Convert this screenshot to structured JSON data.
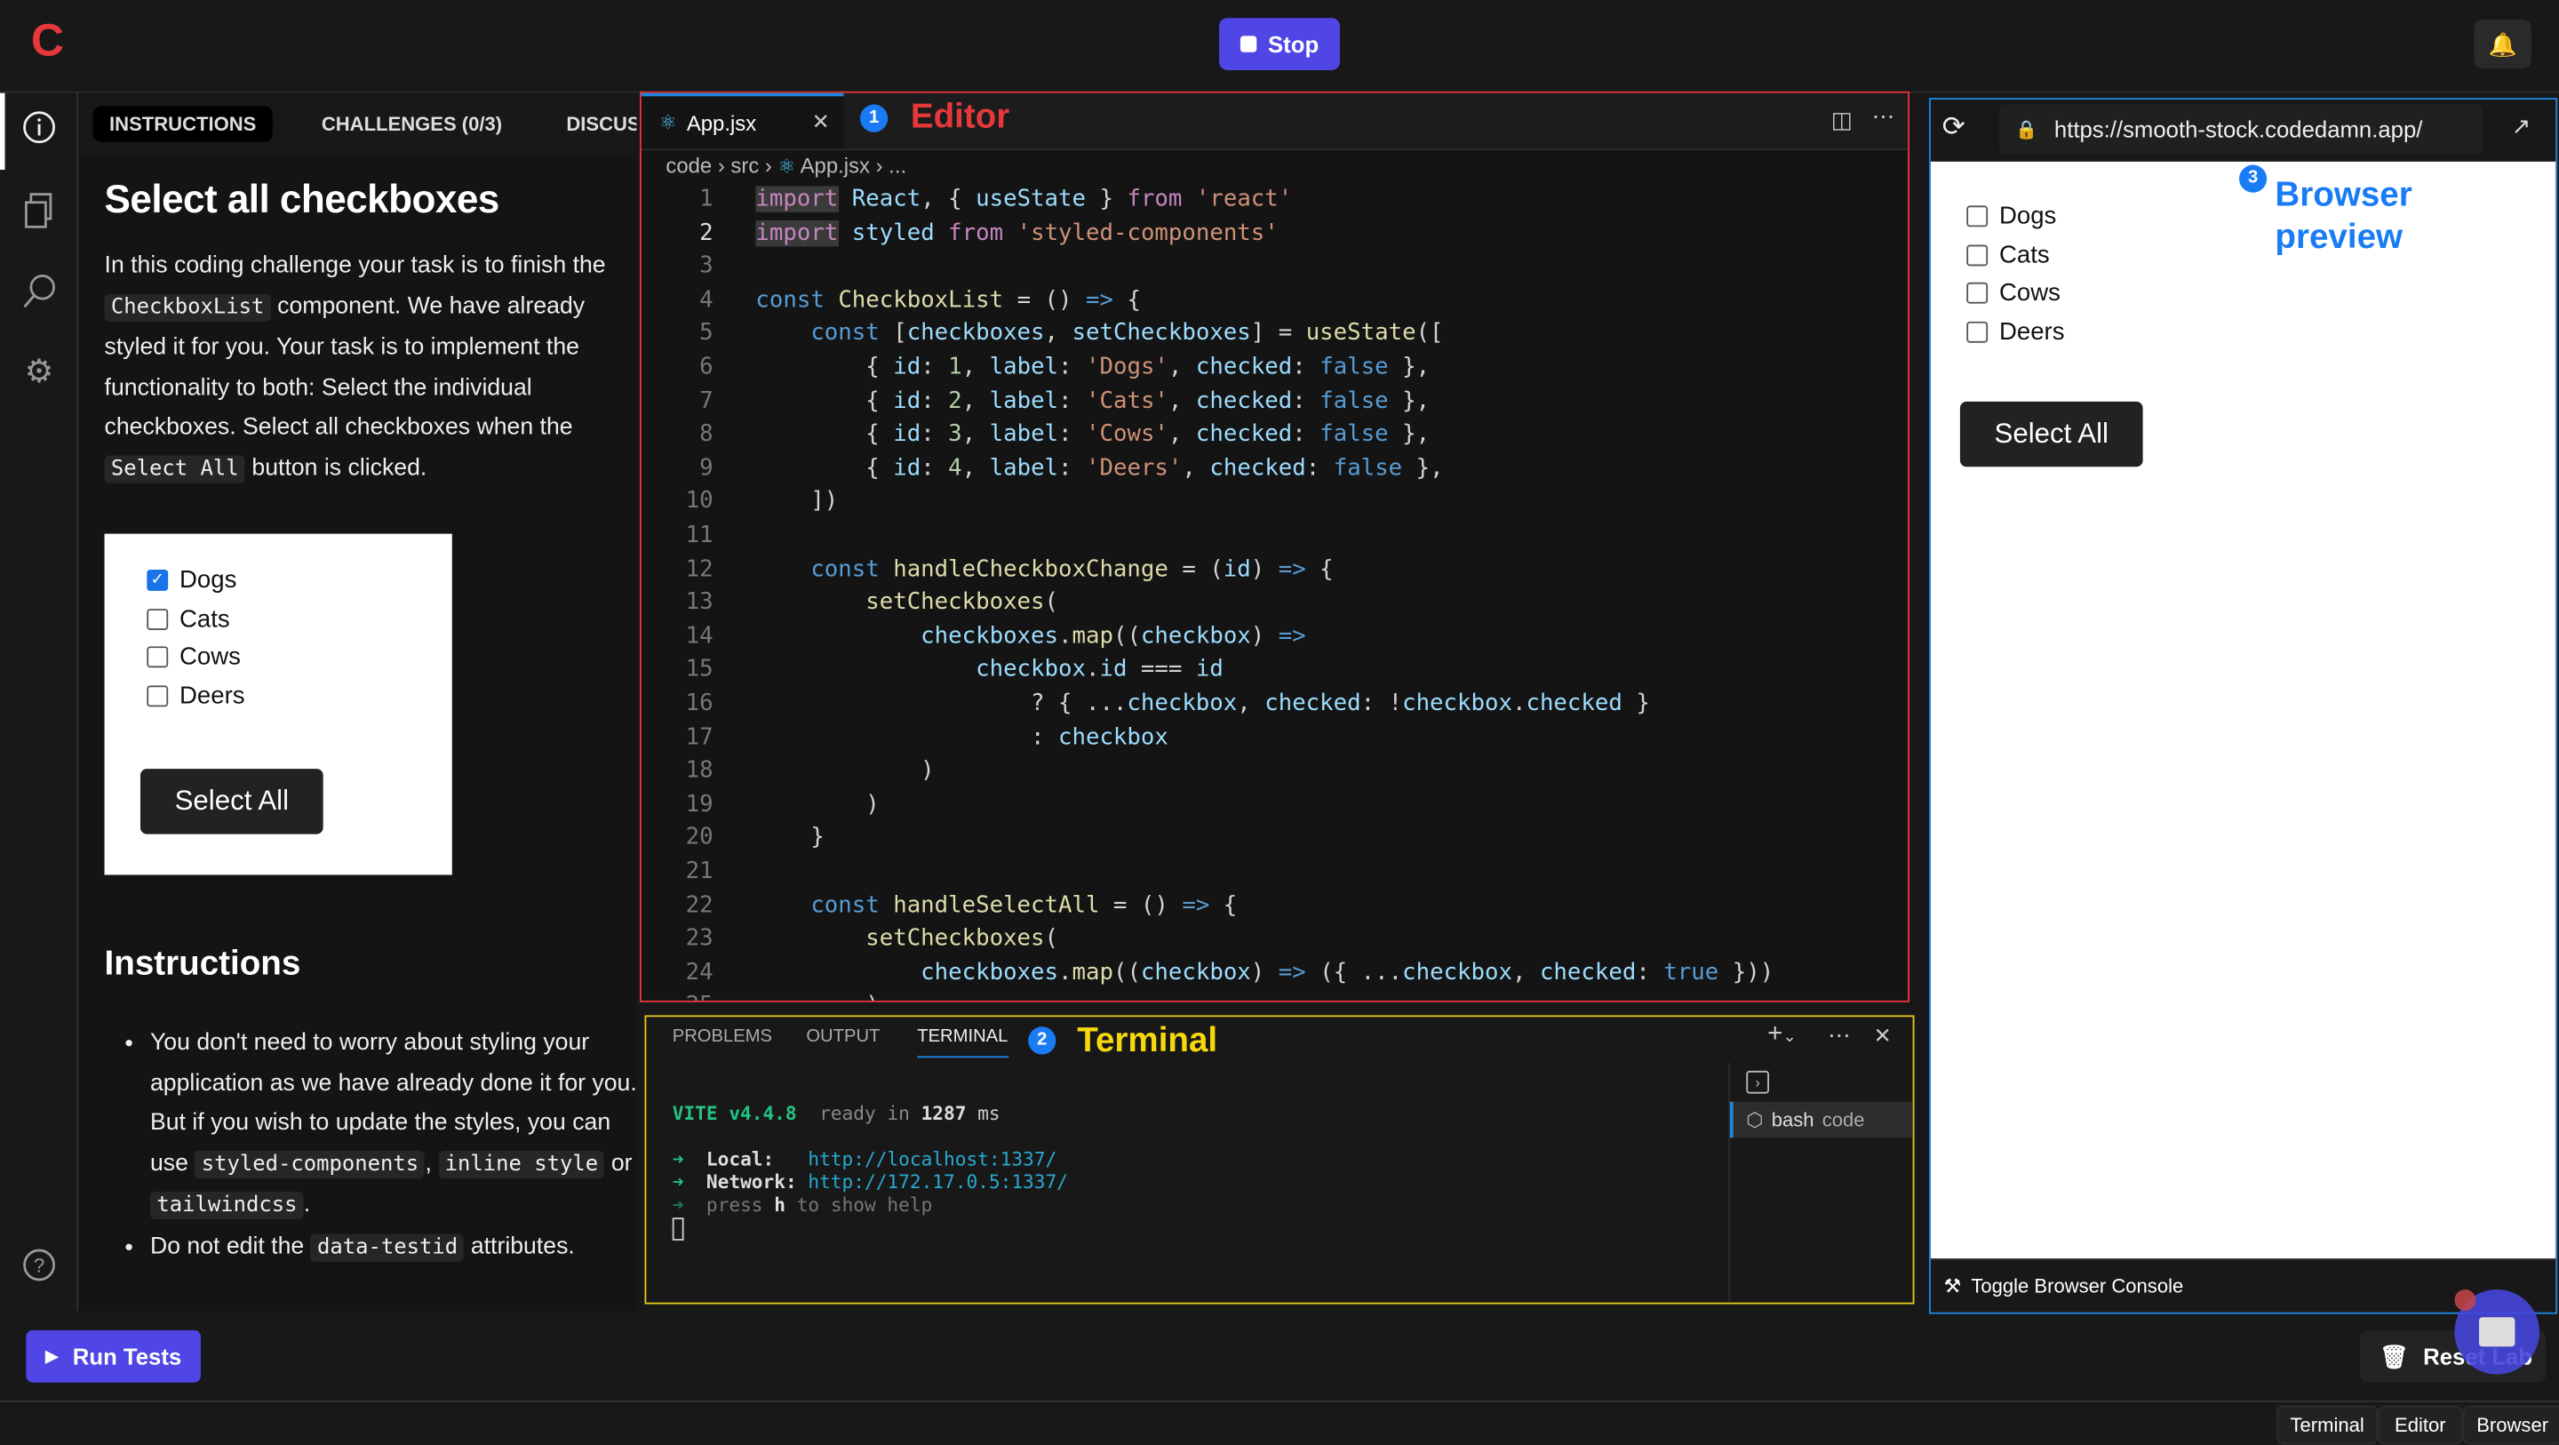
{
  "topbar": {
    "logo": "C",
    "stop_label": "Stop",
    "bell_icon": "bell-icon"
  },
  "rail": {
    "icons": [
      "info-icon",
      "files-icon",
      "search-icon",
      "gear-icon",
      "help-icon"
    ]
  },
  "instructions": {
    "tabs": [
      "INSTRUCTIONS",
      "CHALLENGES (0/3)",
      "DISCUSSIONS"
    ],
    "title": "Select all checkboxes",
    "intro": [
      "In this coding challenge your task is to finish the ",
      "CheckboxList",
      " component. We have already styled it for you. Your task is to implement the functionality to both: Select the individual checkboxes. Select all checkboxes when the ",
      "Select All",
      " button is clicked."
    ],
    "demo": {
      "items": [
        {
          "label": "Dogs",
          "checked": true
        },
        {
          "label": "Cats",
          "checked": false
        },
        {
          "label": "Cows",
          "checked": false
        },
        {
          "label": "Deers",
          "checked": false
        }
      ],
      "button": "Select All"
    },
    "heading": "Instructions",
    "bullets": [
      [
        "You don't need to worry about styling your application as we have already done it for you. But if you wish to update the styles, you can use ",
        "styled-components",
        ", ",
        "inline style",
        " or ",
        "tailwindcss",
        "."
      ],
      [
        "Do not edit the ",
        "data-testid",
        " attributes."
      ]
    ]
  },
  "editor": {
    "tab": "App.jsx",
    "badge": "1",
    "label": "Editor",
    "breadcrumb": [
      "code",
      "src",
      "App.jsx",
      "..."
    ],
    "lines": [
      [
        [
          "kw",
          "import"
        ],
        [
          "vr",
          " React"
        ],
        [
          "pu",
          ", { "
        ],
        [
          "vr",
          "useState"
        ],
        [
          "pu",
          " } "
        ],
        [
          "kw",
          "from"
        ],
        [
          "st",
          " 'react'"
        ]
      ],
      [
        [
          "kw",
          "import"
        ],
        [
          "vr",
          " styled"
        ],
        [
          "kw",
          " from"
        ],
        [
          "st",
          " 'styled-components'"
        ]
      ],
      [],
      [
        [
          "bl",
          "const"
        ],
        [
          "fn",
          " CheckboxList"
        ],
        [
          "pu",
          " = () "
        ],
        [
          "bl",
          "=>"
        ],
        [
          "pu",
          " {"
        ]
      ],
      [
        [
          "bl",
          "    const"
        ],
        [
          "pu",
          " ["
        ],
        [
          "vr",
          "checkboxes"
        ],
        [
          "pu",
          ", "
        ],
        [
          "vr",
          "setCheckboxes"
        ],
        [
          "pu",
          "] = "
        ],
        [
          "fn",
          "useState"
        ],
        [
          "pu",
          "(["
        ]
      ],
      [
        [
          "pu",
          "        { "
        ],
        [
          "vr",
          "id"
        ],
        [
          "pu",
          ": "
        ],
        [
          "nm",
          "1"
        ],
        [
          "pu",
          ", "
        ],
        [
          "vr",
          "label"
        ],
        [
          "pu",
          ": "
        ],
        [
          "st",
          "'Dogs'"
        ],
        [
          "pu",
          ", "
        ],
        [
          "vr",
          "checked"
        ],
        [
          "pu",
          ": "
        ],
        [
          "bl",
          "false"
        ],
        [
          "pu",
          " },"
        ]
      ],
      [
        [
          "pu",
          "        { "
        ],
        [
          "vr",
          "id"
        ],
        [
          "pu",
          ": "
        ],
        [
          "nm",
          "2"
        ],
        [
          "pu",
          ", "
        ],
        [
          "vr",
          "label"
        ],
        [
          "pu",
          ": "
        ],
        [
          "st",
          "'Cats'"
        ],
        [
          "pu",
          ", "
        ],
        [
          "vr",
          "checked"
        ],
        [
          "pu",
          ": "
        ],
        [
          "bl",
          "false"
        ],
        [
          "pu",
          " },"
        ]
      ],
      [
        [
          "pu",
          "        { "
        ],
        [
          "vr",
          "id"
        ],
        [
          "pu",
          ": "
        ],
        [
          "nm",
          "3"
        ],
        [
          "pu",
          ", "
        ],
        [
          "vr",
          "label"
        ],
        [
          "pu",
          ": "
        ],
        [
          "st",
          "'Cows'"
        ],
        [
          "pu",
          ", "
        ],
        [
          "vr",
          "checked"
        ],
        [
          "pu",
          ": "
        ],
        [
          "bl",
          "false"
        ],
        [
          "pu",
          " },"
        ]
      ],
      [
        [
          "pu",
          "        { "
        ],
        [
          "vr",
          "id"
        ],
        [
          "pu",
          ": "
        ],
        [
          "nm",
          "4"
        ],
        [
          "pu",
          ", "
        ],
        [
          "vr",
          "label"
        ],
        [
          "pu",
          ": "
        ],
        [
          "st",
          "'Deers'"
        ],
        [
          "pu",
          ", "
        ],
        [
          "vr",
          "checked"
        ],
        [
          "pu",
          ": "
        ],
        [
          "bl",
          "false"
        ],
        [
          "pu",
          " },"
        ]
      ],
      [
        [
          "pu",
          "    ])"
        ]
      ],
      [],
      [
        [
          "bl",
          "    const"
        ],
        [
          "fn",
          " handleCheckboxChange"
        ],
        [
          "pu",
          " = ("
        ],
        [
          "vr",
          "id"
        ],
        [
          "pu",
          ") "
        ],
        [
          "bl",
          "=>"
        ],
        [
          "pu",
          " {"
        ]
      ],
      [
        [
          "fn",
          "        setCheckboxes"
        ],
        [
          "pu",
          "("
        ]
      ],
      [
        [
          "vr",
          "            checkboxes"
        ],
        [
          "pu",
          "."
        ],
        [
          "fn",
          "map"
        ],
        [
          "pu",
          "(("
        ],
        [
          "vr",
          "checkbox"
        ],
        [
          "pu",
          ") "
        ],
        [
          "bl",
          "=>"
        ]
      ],
      [
        [
          "vr",
          "                checkbox"
        ],
        [
          "pu",
          "."
        ],
        [
          "vr",
          "id"
        ],
        [
          "pu",
          " === "
        ],
        [
          "vr",
          "id"
        ]
      ],
      [
        [
          "pu",
          "                    ? { ..."
        ],
        [
          "vr",
          "checkbox"
        ],
        [
          "pu",
          ", "
        ],
        [
          "vr",
          "checked"
        ],
        [
          "pu",
          ": !"
        ],
        [
          "vr",
          "checkbox"
        ],
        [
          "pu",
          "."
        ],
        [
          "vr",
          "checked"
        ],
        [
          "pu",
          " }"
        ]
      ],
      [
        [
          "pu",
          "                    : "
        ],
        [
          "vr",
          "checkbox"
        ]
      ],
      [
        [
          "pu",
          "            )"
        ]
      ],
      [
        [
          "pu",
          "        )"
        ]
      ],
      [
        [
          "pu",
          "    }"
        ]
      ],
      [],
      [
        [
          "bl",
          "    const"
        ],
        [
          "fn",
          " handleSelectAll"
        ],
        [
          "pu",
          " = () "
        ],
        [
          "bl",
          "=>"
        ],
        [
          "pu",
          " {"
        ]
      ],
      [
        [
          "fn",
          "        setCheckboxes"
        ],
        [
          "pu",
          "("
        ]
      ],
      [
        [
          "vr",
          "            checkboxes"
        ],
        [
          "pu",
          "."
        ],
        [
          "fn",
          "map"
        ],
        [
          "pu",
          "(("
        ],
        [
          "vr",
          "checkbox"
        ],
        [
          "pu",
          ") "
        ],
        [
          "bl",
          "=>"
        ],
        [
          "pu",
          " ({ ..."
        ],
        [
          "vr",
          "checkbox"
        ],
        [
          "pu",
          ", "
        ],
        [
          "vr",
          "checked"
        ],
        [
          "pu",
          ": "
        ],
        [
          "bl",
          "true"
        ],
        [
          "pu",
          " }))"
        ]
      ],
      [
        [
          "pu",
          "        )"
        ]
      ]
    ]
  },
  "terminal": {
    "tabs": [
      "PROBLEMS",
      "OUTPUT",
      "TERMINAL"
    ],
    "badge": "2",
    "label": "Terminal",
    "vite": "VITE v4.4.8",
    "ready": "ready in",
    "ms_value": "1287",
    "ms": "ms",
    "local_label": "Local:",
    "local_url": "http://localhost:1337/",
    "network_label": "Network:",
    "network_url": "http://172.17.0.5:1337/",
    "help": [
      "press ",
      "h",
      " to show help"
    ],
    "shell": "bash",
    "shell_dir": "code"
  },
  "browser": {
    "url": "https://smooth-stock.codedamn.app/",
    "badge": "3",
    "label": "Browser preview",
    "items": [
      {
        "label": "Dogs",
        "checked": false
      },
      {
        "label": "Cats",
        "checked": false
      },
      {
        "label": "Cows",
        "checked": false
      },
      {
        "label": "Deers",
        "checked": false
      }
    ],
    "button": "Select All",
    "console": "Toggle Browser Console"
  },
  "bottom": {
    "run_tests": "Run Tests",
    "reset_lab": "Reset Lab"
  },
  "footer": {
    "buttons": [
      "Terminal",
      "Editor",
      "Browser"
    ]
  },
  "colors": {
    "accent": "#4f46e5",
    "editor_border": "#e5383b",
    "terminal_border": "#e8c81a",
    "browser_border": "#1e88e5"
  }
}
